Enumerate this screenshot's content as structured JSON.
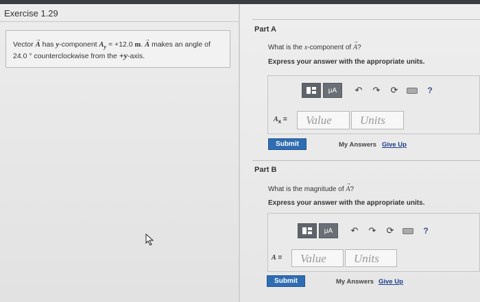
{
  "exercise": {
    "title": "Exercise 1.29"
  },
  "problem": {
    "t1": "Vector ",
    "vec_a": "A",
    "t2": " has ",
    "y_var": "y",
    "t3": "-component ",
    "ay_var": "A",
    "ay_sub": "y",
    "t4": " = +12.0 ",
    "unit_m": "m",
    "t5": ". ",
    "vec_a2": "A",
    "t6": " makes an angle of",
    "t7": "24.0 ° counterclockwise from the ",
    "plus_y": "+y",
    "t8": "-axis."
  },
  "part_a": {
    "title": "Part A",
    "question_pre": "What is the ",
    "question_var": "x",
    "question_mid": "-component of ",
    "question_vec": "A",
    "question_post": "?",
    "instruction": "Express your answer with the appropriate units.",
    "toolbar": {
      "mu_label": "μA",
      "help_label": "?"
    },
    "input_label_var": "A",
    "input_label_sub": "x",
    "input_label_eq": " =",
    "value_placeholder": "Value",
    "units_placeholder": "Units",
    "submit_label": "Submit",
    "my_answers_label": "My Answers",
    "give_up_label": "Give Up"
  },
  "part_b": {
    "title": "Part B",
    "question_pre": "What is the magnitude of ",
    "question_vec": "A",
    "question_post": "?",
    "instruction": "Express your answer with the appropriate units.",
    "toolbar": {
      "mu_label": "μA",
      "help_label": "?"
    },
    "input_label_var": "A",
    "input_label_eq": " =",
    "value_placeholder": "Value",
    "units_placeholder": "Units",
    "submit_label": "Submit",
    "my_answers_label": "My Answers",
    "give_up_label": "Give Up"
  },
  "colors": {
    "accent": "#2f6db3",
    "link": "#1a3a8a",
    "toolbar": "#6a6f75"
  },
  "icons": [
    "templates-icon",
    "undo-icon",
    "redo-icon",
    "reset-icon",
    "keyboard-icon",
    "help-icon",
    "mouse-cursor-icon"
  ]
}
